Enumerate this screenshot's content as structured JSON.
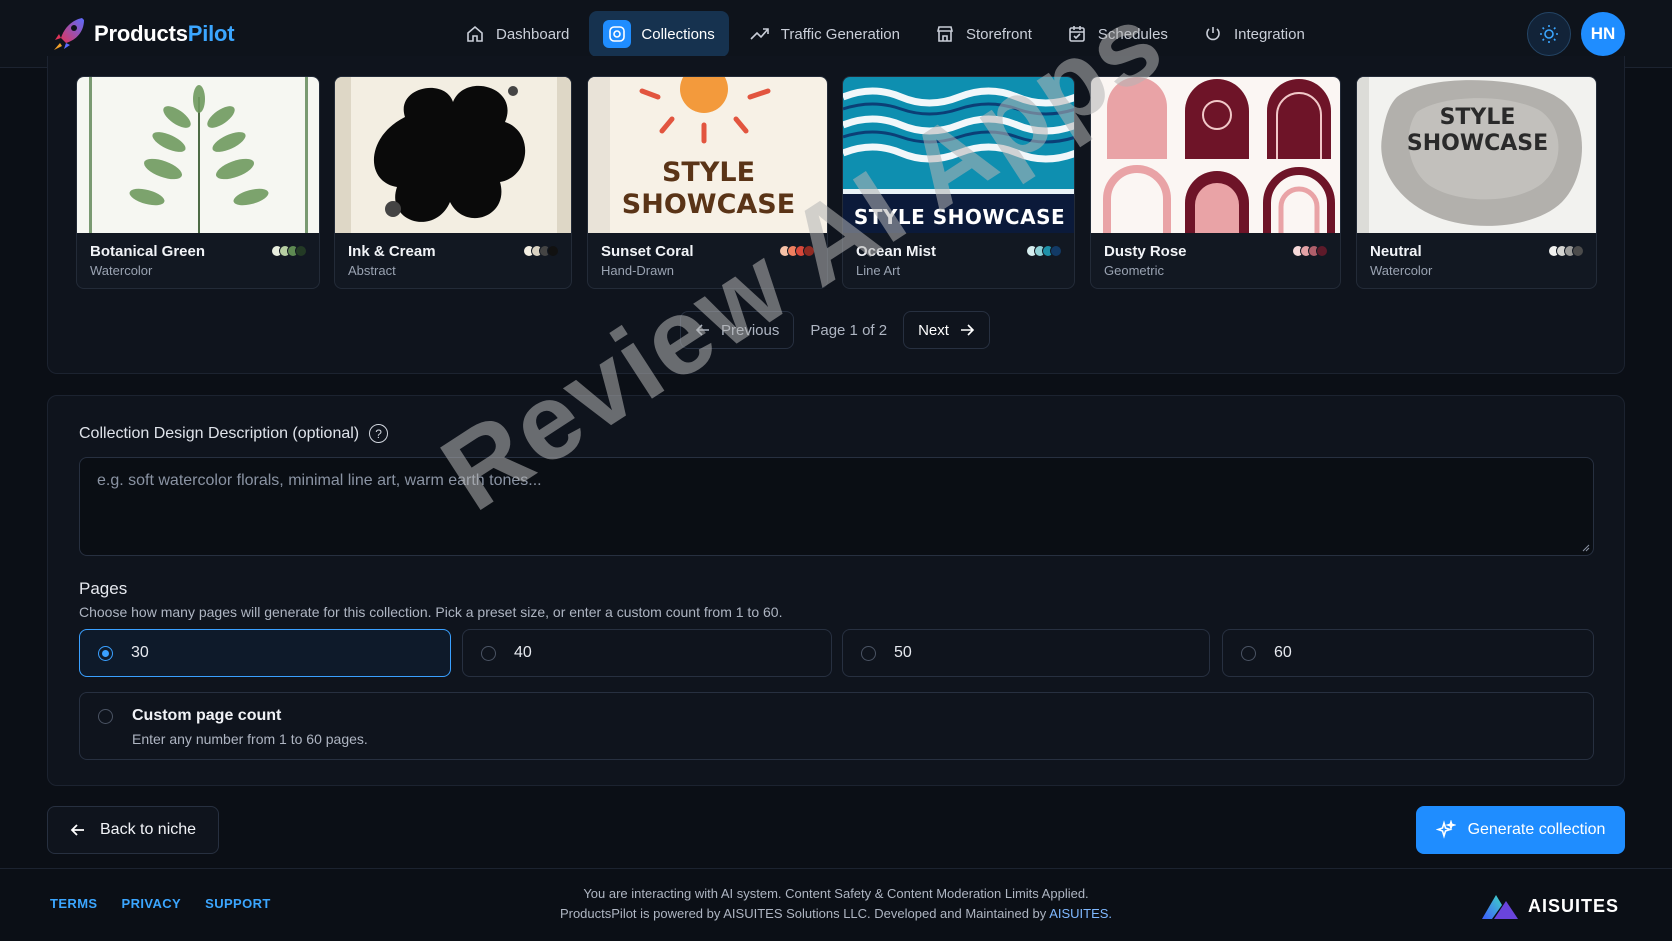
{
  "app": {
    "name_primary": "Products",
    "name_accent": "Pilot",
    "avatar_initials": "HN"
  },
  "nav": [
    {
      "label": "Dashboard",
      "icon": "home-icon"
    },
    {
      "label": "Collections",
      "icon": "collections-icon",
      "active": true
    },
    {
      "label": "Traffic Generation",
      "icon": "trend-icon"
    },
    {
      "label": "Storefront",
      "icon": "store-icon"
    },
    {
      "label": "Schedules",
      "icon": "calendar-icon"
    },
    {
      "label": "Integration",
      "icon": "plug-icon"
    }
  ],
  "styles": [
    {
      "name": "Botanical Green",
      "style": "Watercolor",
      "swatches": [
        "#e8eedf",
        "#b7cfa3",
        "#5e8a52",
        "#233a25"
      ]
    },
    {
      "name": "Ink & Cream",
      "style": "Abstract",
      "swatches": [
        "#f4efe3",
        "#d9d2c2",
        "#444444",
        "#111111"
      ]
    },
    {
      "name": "Sunset Coral",
      "style": "Hand-Drawn",
      "swatches": [
        "#f6c2a8",
        "#ef7f5f",
        "#d8473a",
        "#8f2a22"
      ]
    },
    {
      "name": "Ocean Mist",
      "style": "Line Art",
      "swatches": [
        "#d7eef0",
        "#8fd0d6",
        "#1e90a8",
        "#123a66"
      ]
    },
    {
      "name": "Dusty Rose",
      "style": "Geometric",
      "swatches": [
        "#f6d9d9",
        "#e3a2a6",
        "#b05f6b",
        "#5e1a2a"
      ]
    },
    {
      "name": "Neutral",
      "style": "Watercolor",
      "swatches": [
        "#f2f2f0",
        "#d5d5d2",
        "#9a9a98",
        "#4b4b4b"
      ]
    }
  ],
  "thumb_text": {
    "line1": "STYLE",
    "line2": "SHOWCASE",
    "single": "STYLE SHOWCASE"
  },
  "pagination": {
    "previous": "Previous",
    "info": "Page 1 of 2",
    "next": "Next"
  },
  "description": {
    "label": "Collection Design Description (optional)",
    "help": "?",
    "placeholder": "e.g. soft watercolor florals, minimal line art, warm earth tones..."
  },
  "pages": {
    "title": "Pages",
    "description": "Choose how many pages will generate for this collection. Pick a preset size, or enter a custom count from 1 to 60.",
    "options": [
      "30",
      "40",
      "50",
      "60"
    ],
    "selected": "30",
    "custom_title": "Custom page count",
    "custom_desc": "Enter any number from 1 to 60 pages."
  },
  "actions": {
    "back": "Back to niche",
    "generate": "Generate collection"
  },
  "footer": {
    "links": [
      "TERMS",
      "PRIVACY",
      "SUPPORT"
    ],
    "line1": "You are interacting with AI system. Content Safety & Content Moderation Limits Applied.",
    "line2_prefix": "ProductsPilot is powered by AISUITES Solutions LLC. Developed and Maintained by ",
    "line2_link": "AISUITES.",
    "brand": "AISUITES"
  },
  "watermark": "Review AI Apps",
  "colors": {
    "accent": "#1f8dff",
    "background": "#0b0f16",
    "panel": "#0f141d"
  }
}
